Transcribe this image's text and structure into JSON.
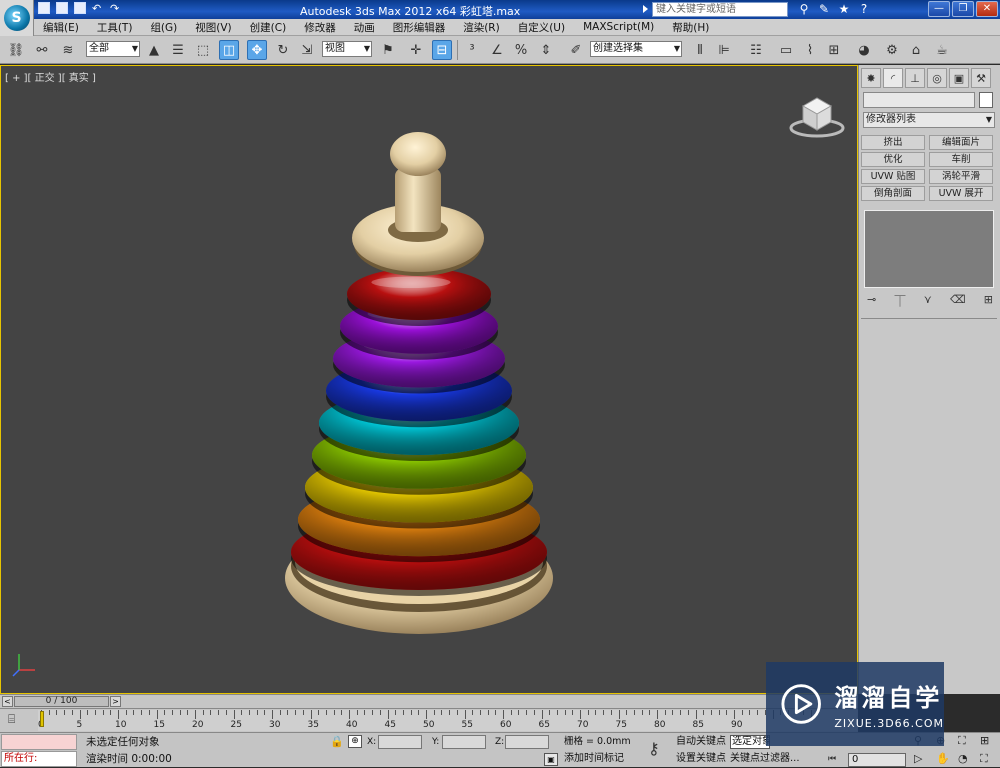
{
  "app": {
    "title": "Autodesk 3ds Max  2012 x64      彩虹塔.max",
    "search_placeholder": "键入关键字或短语",
    "logo_text": "S"
  },
  "menu": [
    "编辑(E)",
    "工具(T)",
    "组(G)",
    "视图(V)",
    "创建(C)",
    "修改器",
    "动画",
    "图形编辑器",
    "渲染(R)",
    "自定义(U)",
    "MAXScript(M)",
    "帮助(H)"
  ],
  "toolbar": {
    "selection_filter": "全部",
    "ref_coord": "视图",
    "named_selection": "创建选择集"
  },
  "viewport": {
    "label": "[ + ][ 正交 ][ 真实 ]",
    "active_border_color": "#e7c400",
    "background_color": "#444444"
  },
  "command_panel": {
    "modifier_list": "修改器列表",
    "modifier_buttons": [
      "挤出",
      "编辑面片",
      "优化",
      "车削",
      "UVW 贴图",
      "涡轮平滑",
      "倒角剖面",
      "UVW 展开"
    ],
    "tabs": [
      "create-icon",
      "modify-icon",
      "hierarchy-icon",
      "motion-icon",
      "display-icon",
      "utilities-icon"
    ]
  },
  "timeline": {
    "slider_text": "0 / 100",
    "ruler_labels": [
      "0",
      "5",
      "10",
      "15",
      "20",
      "25",
      "30",
      "35",
      "40",
      "45",
      "50",
      "55",
      "60",
      "65",
      "70",
      "75",
      "80",
      "85",
      "90"
    ]
  },
  "status": {
    "running": "所在行:",
    "message": "未选定任何对象",
    "render_time": "渲染时间  0:00:00",
    "x_label": "X:",
    "y_label": "Y:",
    "z_label": "Z:",
    "grid": "栅格 = 0.0mm",
    "add_time_tag": "添加时间标记",
    "auto_key": "自动关键点",
    "set_key": "设置关键点",
    "selected": "选定对象",
    "key_filters": "关键点过滤器...",
    "frame": "0"
  },
  "watermark": {
    "title": "溜溜自学",
    "url": "ZIXUE.3D66.COM"
  },
  "rings": [
    {
      "color": "#d01010"
    },
    {
      "color": "#f08a10"
    },
    {
      "color": "#f3d400"
    },
    {
      "color": "#8fcd00"
    },
    {
      "color": "#00c8d8"
    },
    {
      "color": "#1838e0"
    },
    {
      "color": "#9a18e0"
    },
    {
      "color": "#9a10d8"
    },
    {
      "color": "#b81010"
    }
  ],
  "colors": {
    "wood": "#e3cfa4",
    "accent": "#5aa6e8"
  }
}
